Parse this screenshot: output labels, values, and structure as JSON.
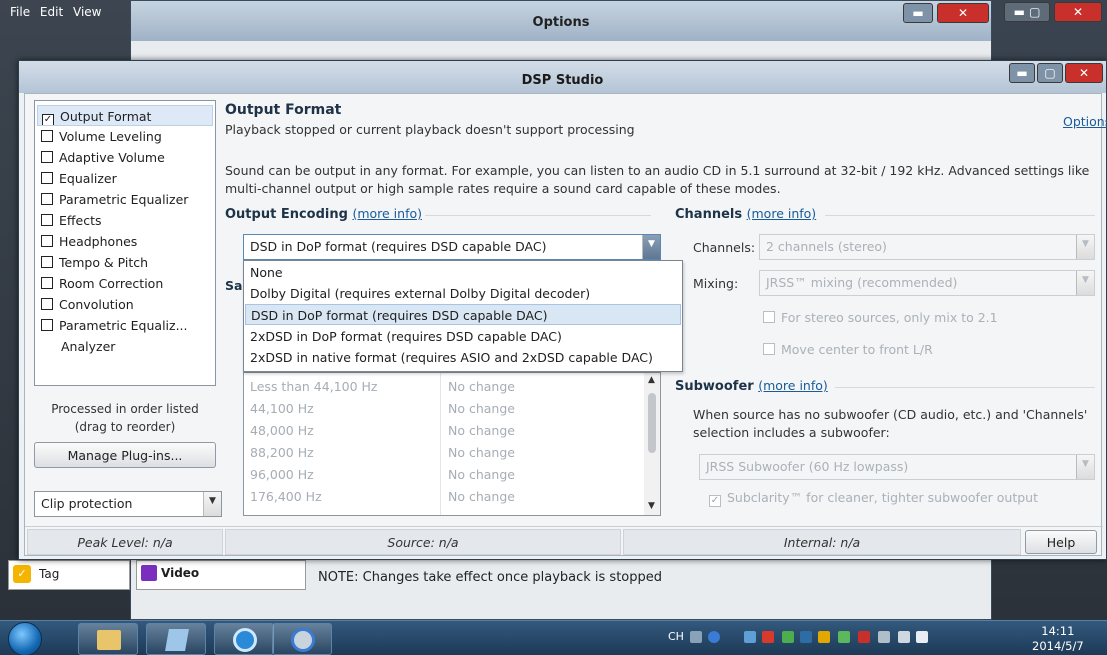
{
  "background": {
    "menu": [
      "File",
      "Edit",
      "View"
    ],
    "options_title": "Options",
    "tag_label": "Tag",
    "video_label": "Video",
    "note": "NOTE: Changes take effect once playback is stopped"
  },
  "dsp": {
    "title": "DSP Studio",
    "plugins": [
      {
        "label": "Output Format",
        "checked": true
      },
      {
        "label": "Volume Leveling",
        "checked": false
      },
      {
        "label": "Adaptive Volume",
        "checked": false
      },
      {
        "label": "Equalizer",
        "checked": false
      },
      {
        "label": "Parametric Equalizer",
        "checked": false
      },
      {
        "label": "Effects",
        "checked": false
      },
      {
        "label": "Headphones",
        "checked": false
      },
      {
        "label": "Tempo & Pitch",
        "checked": false
      },
      {
        "label": "Room Correction",
        "checked": false
      },
      {
        "label": "Convolution",
        "checked": false
      },
      {
        "label": "Parametric Equaliz...",
        "checked": false
      },
      {
        "label": "Analyzer",
        "checked": null
      }
    ],
    "processed_note": "Processed in order listed (drag to reorder)",
    "manage_button": "Manage Plug-ins...",
    "clip_protection": "Clip protection",
    "panel": {
      "title": "Output Format",
      "subtitle": "Playback stopped or current playback doesn't support processing",
      "options_link": "Options",
      "description": "Sound can be output in any format.  For example, you can listen to an audio CD in 5.1 surround at 32-bit / 192 kHz.  Advanced settings like multi-channel output or high sample rates require a sound card capable of these modes.",
      "encoding_heading": "Output Encoding",
      "more_info": "(more info)",
      "encoding_value": "DSD in DoP format (requires DSD capable DAC)",
      "encoding_options": [
        "None",
        "Dolby Digital (requires external Dolby Digital decoder)",
        "DSD in DoP format (requires DSD capable DAC)",
        "2xDSD in DoP format (requires DSD capable DAC)",
        "2xDSD in native format (requires ASIO and 2xDSD capable DAC)"
      ],
      "sample_rate_stub": "Sa",
      "rates": [
        {
          "rate": "Less than 44,100 Hz",
          "action": "No change"
        },
        {
          "rate": "44,100 Hz",
          "action": "No change"
        },
        {
          "rate": "48,000 Hz",
          "action": "No change"
        },
        {
          "rate": "88,200 Hz",
          "action": "No change"
        },
        {
          "rate": "96,000 Hz",
          "action": "No change"
        },
        {
          "rate": "176,400 Hz",
          "action": "No change"
        }
      ],
      "channels_heading": "Channels",
      "channels_label": "Channels:",
      "channels_value": "2 channels (stereo)",
      "mixing_label": "Mixing:",
      "mixing_value": "JRSS™ mixing (recommended)",
      "stereo_mix": "For stereo sources, only mix to 2.1",
      "move_center": "Move center to front L/R",
      "subwoofer_heading": "Subwoofer",
      "subwoofer_desc": "When source has no subwoofer (CD audio, etc.) and 'Channels' selection includes a subwoofer:",
      "subwoofer_value": "JRSS Subwoofer (60 Hz lowpass)",
      "subclarity": "Subclarity™ for cleaner, tighter subwoofer output"
    },
    "status": {
      "peak": "Peak Level: n/a",
      "source": "Source: n/a",
      "internal": "Internal: n/a",
      "help": "Help"
    }
  },
  "taskbar": {
    "ime": "CH",
    "time": "14:11",
    "date": "2014/5/7"
  },
  "colors": {
    "accent": "#1a5b99",
    "selection": "#d9e7f5",
    "close_red": "#c9302c"
  }
}
